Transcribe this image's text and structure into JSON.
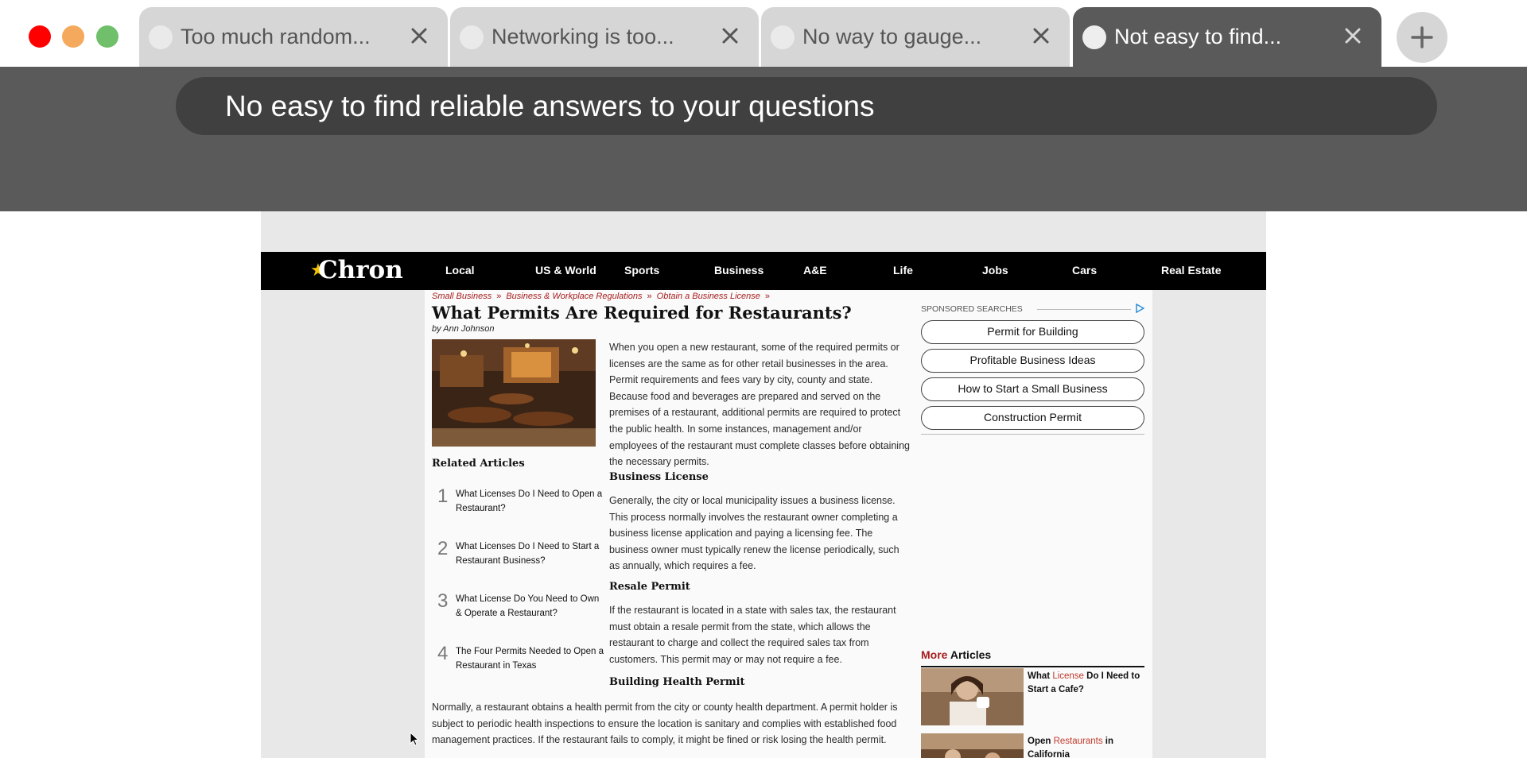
{
  "window": {
    "tabs": [
      {
        "label": "Too much random...",
        "active": false
      },
      {
        "label": "Networking is too...",
        "active": false
      },
      {
        "label": "No way to gauge...",
        "active": false
      },
      {
        "label": "Not easy to find...",
        "active": true
      }
    ],
    "address_bar_text": "No easy to find reliable answers to your questions"
  },
  "site": {
    "logo_text": "Chron",
    "nav": [
      "Local",
      "US & World",
      "Sports",
      "Business",
      "A&E",
      "Life",
      "Jobs",
      "Cars",
      "Real Estate"
    ],
    "breadcrumb": [
      "Small Business",
      "Business & Workplace Regulations",
      "Obtain a Business License"
    ],
    "breadcrumb_sep": "»",
    "article": {
      "title": "What Permits Are Required for Restaurants?",
      "byline": "by Ann Johnson",
      "intro": "When you open a new restaurant, some of the required permits or licenses are the same as for other retail businesses in the area. Permit requirements and fees vary by city, county and state. Because food and beverages are prepared and served on the premises of a restaurant, additional permits are required to protect the public health. In some instances, management and/or employees of the restaurant must complete classes before obtaining the necessary permits.",
      "sections": [
        {
          "heading": "Business License",
          "text": "Generally, the city or local municipality issues a business license. This process normally involves the restaurant owner completing a business license application and paying a licensing fee. The business owner must typically renew the license periodically, such as annually, which requires a fee."
        },
        {
          "heading": "Resale Permit",
          "text": "If the restaurant is located in a state with sales tax, the restaurant must obtain a resale permit from the state, which allows the restaurant to charge and collect the required sales tax from customers. This permit may or may not require a fee."
        },
        {
          "heading": "Building Health Permit",
          "text": "Normally, a restaurant obtains a health permit from the city or county health department. A permit holder is subject to periodic health inspections to ensure the location is sanitary and complies with established food management practices. If the restaurant fails to comply, it might be fined or risk losing the health permit."
        }
      ]
    },
    "related": {
      "title": "Related Articles",
      "items": [
        {
          "num": "1",
          "text": "What Licenses Do I Need to Open a Restaurant?"
        },
        {
          "num": "2",
          "text": "What Licenses Do I Need to Start a Restaurant Business?"
        },
        {
          "num": "3",
          "text": "What License Do You Need to Own & Operate a Restaurant?"
        },
        {
          "num": "4",
          "text": "The Four Permits Needed to Open a Restaurant in Texas"
        }
      ]
    },
    "sponsored": {
      "heading": "SPONSORED SEARCHES",
      "items": [
        "Permit for Building",
        "Profitable Business Ideas",
        "How to Start a Small Business",
        "Construction Permit"
      ]
    },
    "more_articles": {
      "heading_red": "More",
      "heading_rest": "Articles",
      "items": [
        {
          "pre": "What ",
          "highlight": "License",
          "post": " Do I Need to Start a Cafe?"
        },
        {
          "pre": "Open ",
          "highlight": "Restaurants",
          "post": " in California"
        }
      ]
    }
  }
}
